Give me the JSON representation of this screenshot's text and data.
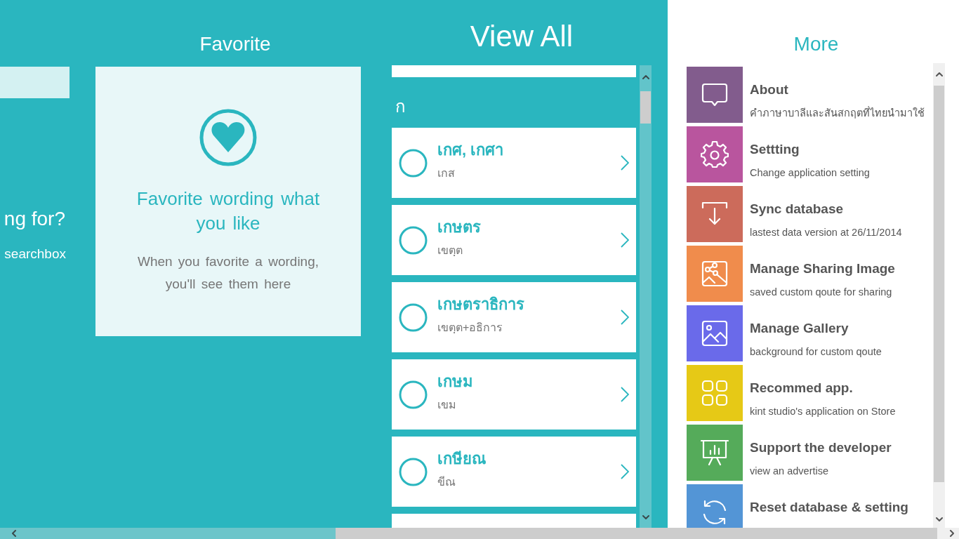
{
  "search_panel": {
    "heading": "ng for?",
    "hint": "searchbox"
  },
  "favorite": {
    "title": "Favorite",
    "empty_heading": "Favorite wording what you like",
    "empty_text": "When you favorite a wording, you'll see them here"
  },
  "view_all": {
    "title": "View All",
    "groups": [
      {
        "letter": "ก",
        "items": [
          {
            "word": "เกศ, เกศา",
            "origin": "เกส"
          },
          {
            "word": "เกษตร",
            "origin": "เขตฺต"
          },
          {
            "word": "เกษตราธิการ",
            "origin": "เขตฺต+อธิการ"
          },
          {
            "word": "เกษม",
            "origin": "เขม"
          },
          {
            "word": "เกษียณ",
            "origin": "ขีณ"
          }
        ]
      }
    ]
  },
  "more": {
    "title": "More",
    "items": [
      {
        "kind": "about",
        "title": "About",
        "subtitle": "คำภาษาบาลีและสันสกฤตที่ไทยนำมาใช้",
        "color": "#825c8d"
      },
      {
        "kind": "settings",
        "title": "Settting",
        "subtitle": "Change application setting",
        "color": "#b9559e"
      },
      {
        "kind": "sync",
        "title": "Sync database",
        "subtitle": "lastest data version at 26/11/2014",
        "color": "#cc6b5b"
      },
      {
        "kind": "sharing",
        "title": "Manage Sharing Image",
        "subtitle": "saved custom qoute for sharing",
        "color": "#f08c4c"
      },
      {
        "kind": "gallery",
        "title": "Manage Gallery",
        "subtitle": "background for custom qoute",
        "color": "#6a6aea"
      },
      {
        "kind": "apps",
        "title": "Recommed app.",
        "subtitle": "kint studio's application on Store",
        "color": "#e6c916"
      },
      {
        "kind": "support",
        "title": "Support the developer",
        "subtitle": "view an advertise",
        "color": "#55ab5a"
      },
      {
        "kind": "reset",
        "title": "Reset database & setting",
        "color": "#5395d6"
      }
    ]
  }
}
